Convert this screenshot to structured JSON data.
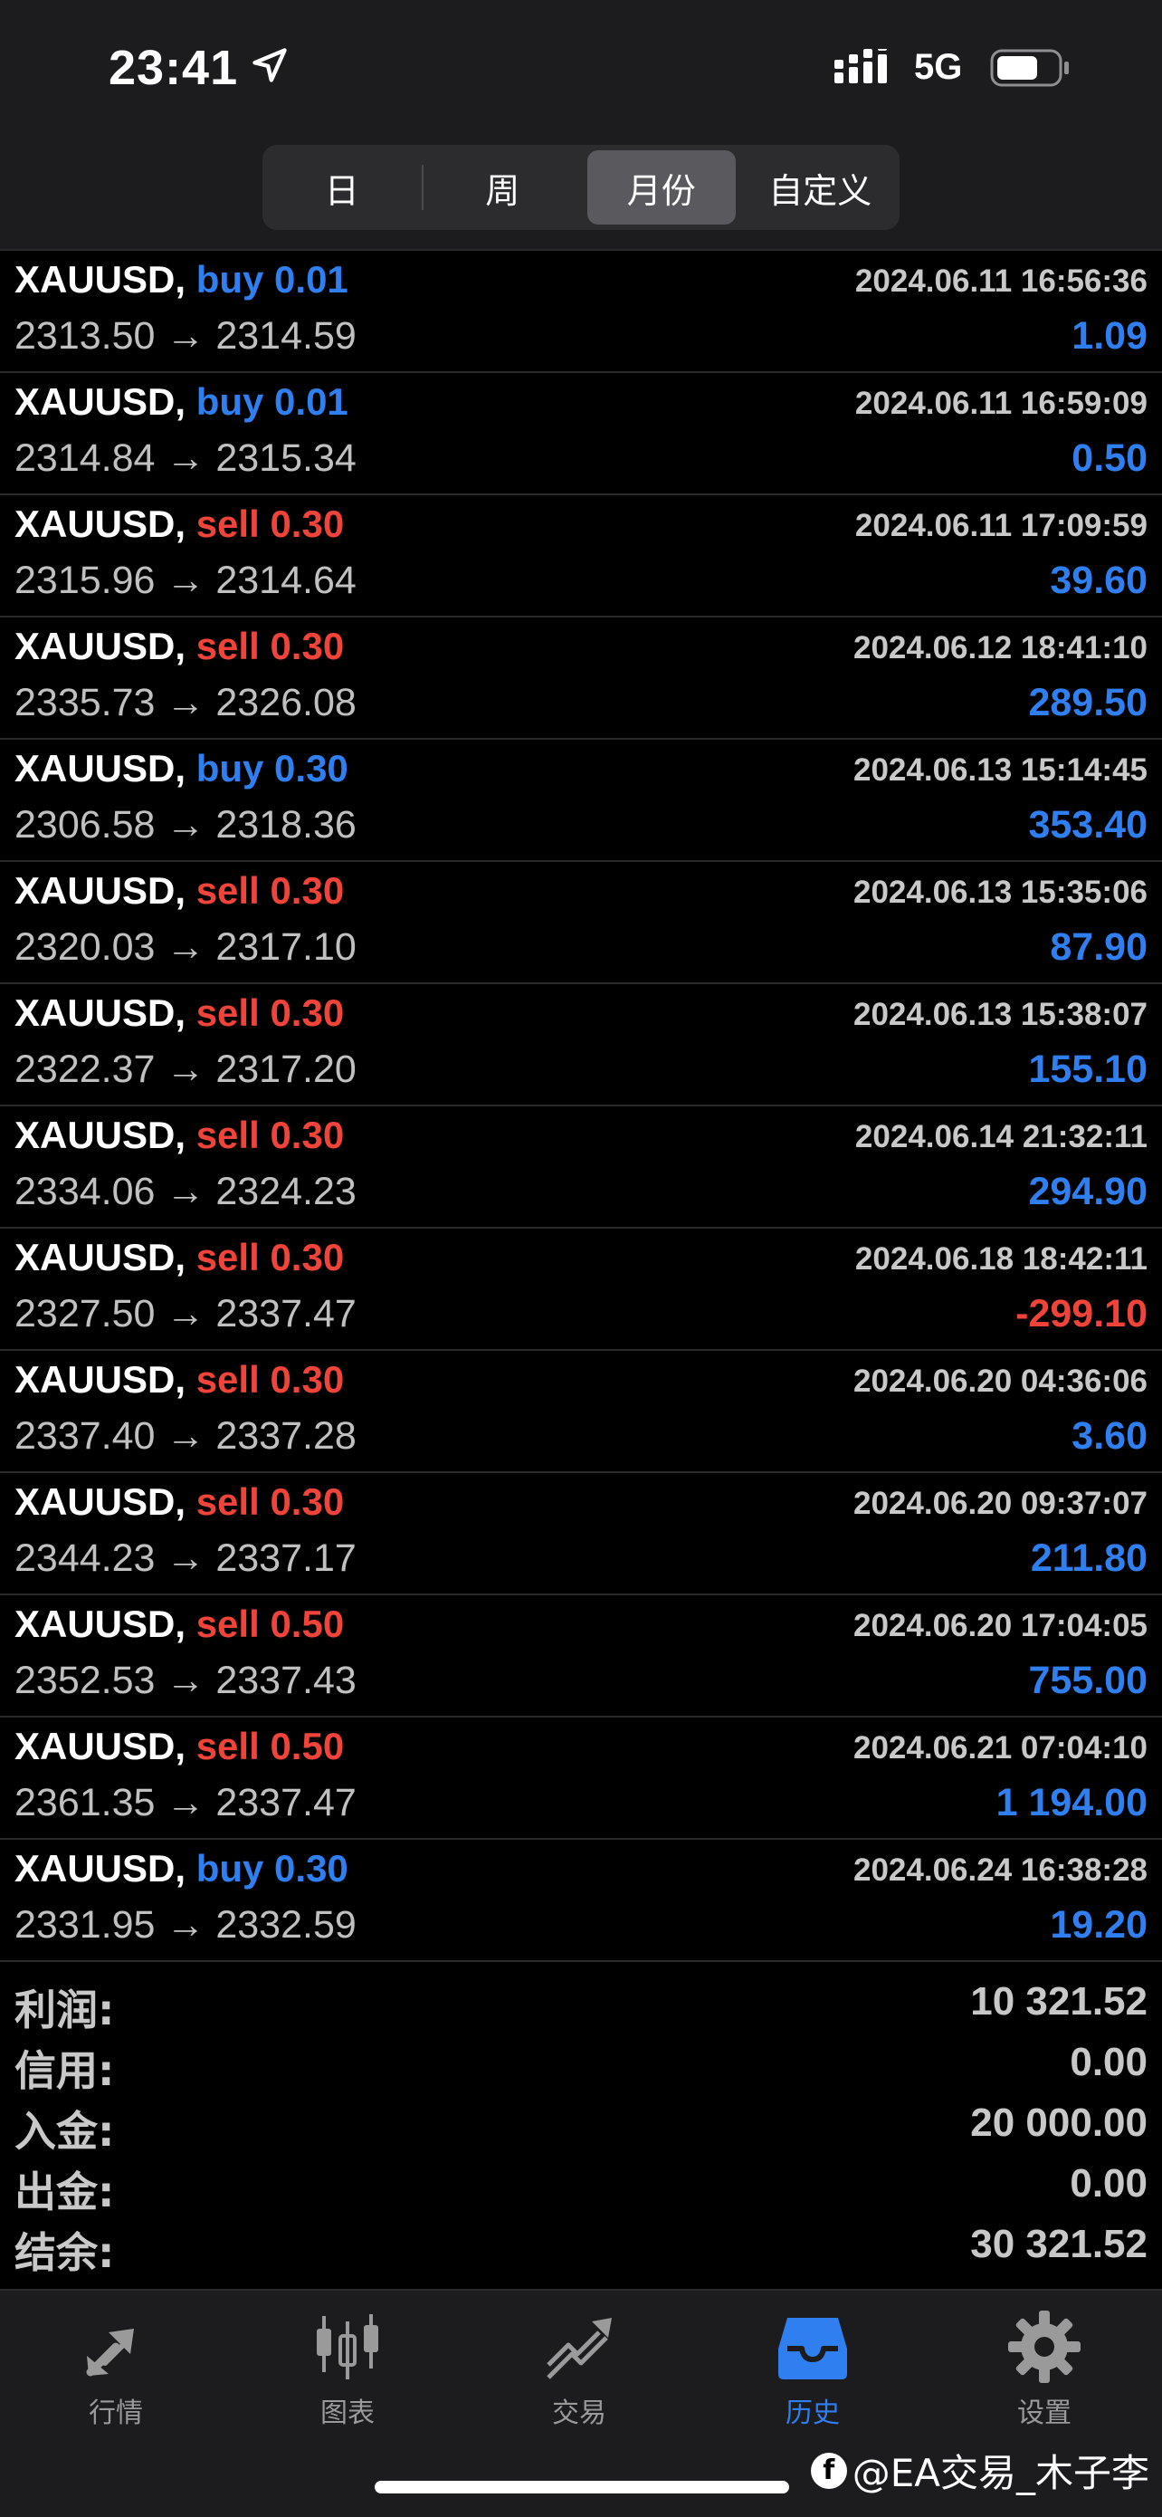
{
  "status_bar": {
    "time": "23:41",
    "network": "5G",
    "icons": [
      "location-arrow-icon",
      "signal-icon",
      "battery-icon"
    ]
  },
  "period_tabs": [
    {
      "label": "日",
      "active": false
    },
    {
      "label": "周",
      "active": false
    },
    {
      "label": "月份",
      "active": true
    },
    {
      "label": "自定义",
      "active": false
    }
  ],
  "trades": [
    {
      "symbol": "XAUUSD,",
      "side": "buy",
      "volume": "0.01",
      "time": "2024.06.11 16:56:36",
      "open": "2313.50",
      "close": "2314.59",
      "profit": "1.09"
    },
    {
      "symbol": "XAUUSD,",
      "side": "buy",
      "volume": "0.01",
      "time": "2024.06.11 16:59:09",
      "open": "2314.84",
      "close": "2315.34",
      "profit": "0.50"
    },
    {
      "symbol": "XAUUSD,",
      "side": "sell",
      "volume": "0.30",
      "time": "2024.06.11 17:09:59",
      "open": "2315.96",
      "close": "2314.64",
      "profit": "39.60"
    },
    {
      "symbol": "XAUUSD,",
      "side": "sell",
      "volume": "0.30",
      "time": "2024.06.12 18:41:10",
      "open": "2335.73",
      "close": "2326.08",
      "profit": "289.50"
    },
    {
      "symbol": "XAUUSD,",
      "side": "buy",
      "volume": "0.30",
      "time": "2024.06.13 15:14:45",
      "open": "2306.58",
      "close": "2318.36",
      "profit": "353.40"
    },
    {
      "symbol": "XAUUSD,",
      "side": "sell",
      "volume": "0.30",
      "time": "2024.06.13 15:35:06",
      "open": "2320.03",
      "close": "2317.10",
      "profit": "87.90"
    },
    {
      "symbol": "XAUUSD,",
      "side": "sell",
      "volume": "0.30",
      "time": "2024.06.13 15:38:07",
      "open": "2322.37",
      "close": "2317.20",
      "profit": "155.10"
    },
    {
      "symbol": "XAUUSD,",
      "side": "sell",
      "volume": "0.30",
      "time": "2024.06.14 21:32:11",
      "open": "2334.06",
      "close": "2324.23",
      "profit": "294.90"
    },
    {
      "symbol": "XAUUSD,",
      "side": "sell",
      "volume": "0.30",
      "time": "2024.06.18 18:42:11",
      "open": "2327.50",
      "close": "2337.47",
      "profit": "-299.10"
    },
    {
      "symbol": "XAUUSD,",
      "side": "sell",
      "volume": "0.30",
      "time": "2024.06.20 04:36:06",
      "open": "2337.40",
      "close": "2337.28",
      "profit": "3.60"
    },
    {
      "symbol": "XAUUSD,",
      "side": "sell",
      "volume": "0.30",
      "time": "2024.06.20 09:37:07",
      "open": "2344.23",
      "close": "2337.17",
      "profit": "211.80"
    },
    {
      "symbol": "XAUUSD,",
      "side": "sell",
      "volume": "0.50",
      "time": "2024.06.20 17:04:05",
      "open": "2352.53",
      "close": "2337.43",
      "profit": "755.00"
    },
    {
      "symbol": "XAUUSD,",
      "side": "sell",
      "volume": "0.50",
      "time": "2024.06.21 07:04:10",
      "open": "2361.35",
      "close": "2337.47",
      "profit": "1 194.00"
    },
    {
      "symbol": "XAUUSD,",
      "side": "buy",
      "volume": "0.30",
      "time": "2024.06.24 16:38:28",
      "open": "2331.95",
      "close": "2332.59",
      "profit": "19.20"
    }
  ],
  "arrow": "→",
  "summary": [
    {
      "label": "利润:",
      "value": "10 321.52"
    },
    {
      "label": "信用:",
      "value": "0.00"
    },
    {
      "label": "入金:",
      "value": "20 000.00"
    },
    {
      "label": "出金:",
      "value": "0.00"
    },
    {
      "label": "结余:",
      "value": "30 321.52"
    }
  ],
  "tab_bar": [
    {
      "label": "行情",
      "icon": "quotes-arrows-icon",
      "active": false
    },
    {
      "label": "图表",
      "icon": "candlestick-chart-icon",
      "active": false
    },
    {
      "label": "交易",
      "icon": "trade-trend-icon",
      "active": false
    },
    {
      "label": "历史",
      "icon": "history-inbox-icon",
      "active": true
    },
    {
      "label": "设置",
      "icon": "gear-icon",
      "active": false
    }
  ],
  "watermark": "@EA交易_木子李",
  "colors": {
    "buy": "#2f7ff0",
    "sell": "#f0433a",
    "profit_positive": "#2f7ff0",
    "profit_negative": "#f0433a",
    "active_tab": "#2f7ff0"
  }
}
